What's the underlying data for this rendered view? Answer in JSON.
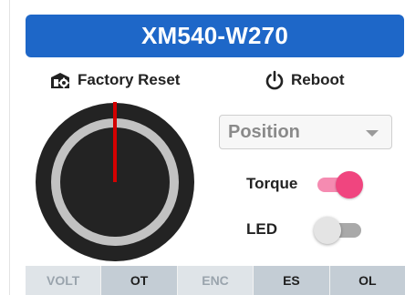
{
  "header": {
    "title": "XM540-W270",
    "color": "#1e67c8"
  },
  "actions": {
    "factory_reset": {
      "label": "Factory Reset",
      "icon": "factory-reset-icon"
    },
    "reboot": {
      "label": "Reboot",
      "icon": "power-icon"
    }
  },
  "dial": {
    "needle_angle_deg": 0,
    "needle_color": "#d40000"
  },
  "mode_select": {
    "value": "Position"
  },
  "toggles": {
    "torque": {
      "label": "Torque",
      "state": "on",
      "color": "#f0457f"
    },
    "led": {
      "label": "LED",
      "state": "off"
    }
  },
  "status": {
    "items": [
      {
        "label": "VOLT",
        "active": false
      },
      {
        "label": "OT",
        "active": true
      },
      {
        "label": "ENC",
        "active": false
      },
      {
        "label": "ES",
        "active": true
      },
      {
        "label": "OL",
        "active": true
      }
    ]
  }
}
